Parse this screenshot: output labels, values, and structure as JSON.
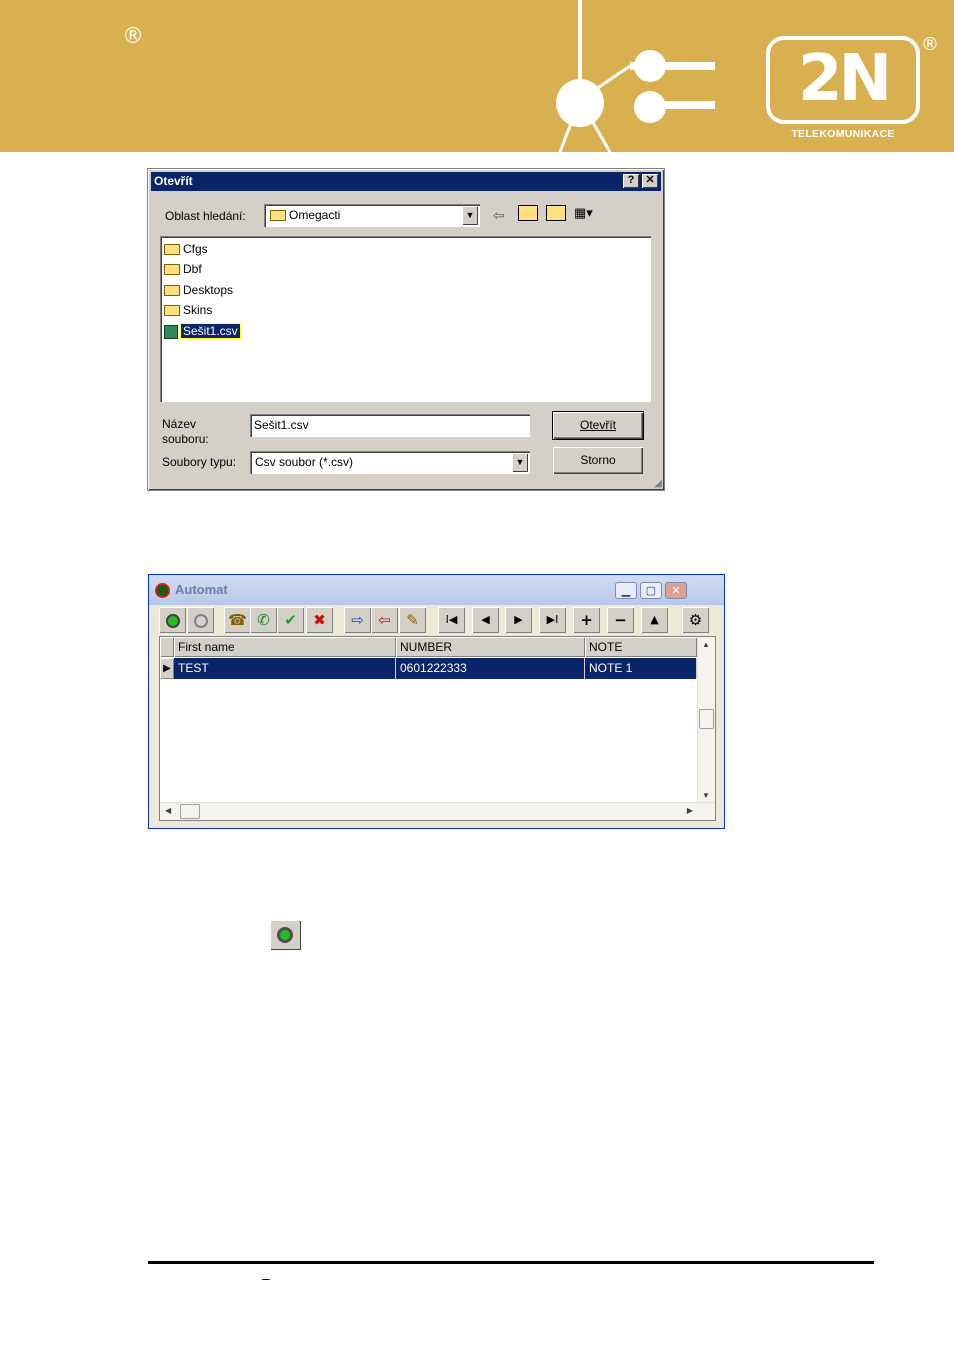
{
  "header": {
    "registered_left": "®",
    "logo_text": "2N",
    "logo_registered": "®",
    "logo_subtitle": "TELEKOMUNIKACE"
  },
  "open_dialog": {
    "title": "Otevřít",
    "help_button": "?",
    "close_button": "✕",
    "look_in_label": "Oblast hledání:",
    "look_in_value": "Omegacti",
    "items": [
      {
        "label": "Cfgs",
        "icon": "folder-icon"
      },
      {
        "label": "Dbf",
        "icon": "folder-icon"
      },
      {
        "label": "Desktops",
        "icon": "folder-icon"
      },
      {
        "label": "Skins",
        "icon": "folder-icon"
      },
      {
        "label": "Sešit1.csv",
        "icon": "csv-file-icon",
        "selected": true
      }
    ],
    "filename_label_line1": "Název",
    "filename_label_line2": "souboru:",
    "filename_value": "Sešit1.csv",
    "filetype_label": "Soubory typu:",
    "filetype_value": "Csv soubor (*.csv)",
    "open_button": "Otevřít",
    "cancel_button": "Storno"
  },
  "automat": {
    "title": "Automat",
    "columns": [
      "First name",
      "NUMBER",
      "NOTE"
    ],
    "rows": [
      {
        "first_name": "TEST",
        "number": "0601222333",
        "note": "NOTE 1"
      }
    ],
    "toolbar_icons": [
      "start-icon",
      "stop-icon",
      "phone-icon",
      "hangup-icon",
      "confirm-icon",
      "cancel-icon",
      "import-icon",
      "export-icon",
      "edit-icon",
      "first-record-icon",
      "prior-record-icon",
      "next-record-icon",
      "last-record-icon",
      "insert-icon",
      "delete-icon",
      "edit-up-icon",
      "settings-icon"
    ],
    "nav_glyphs": {
      "first": "I◀",
      "prior": "◀",
      "next": "▶",
      "last": "▶I",
      "insert": "+",
      "delete": "−",
      "up": "▲"
    }
  },
  "footer": {
    "dash": "–"
  }
}
